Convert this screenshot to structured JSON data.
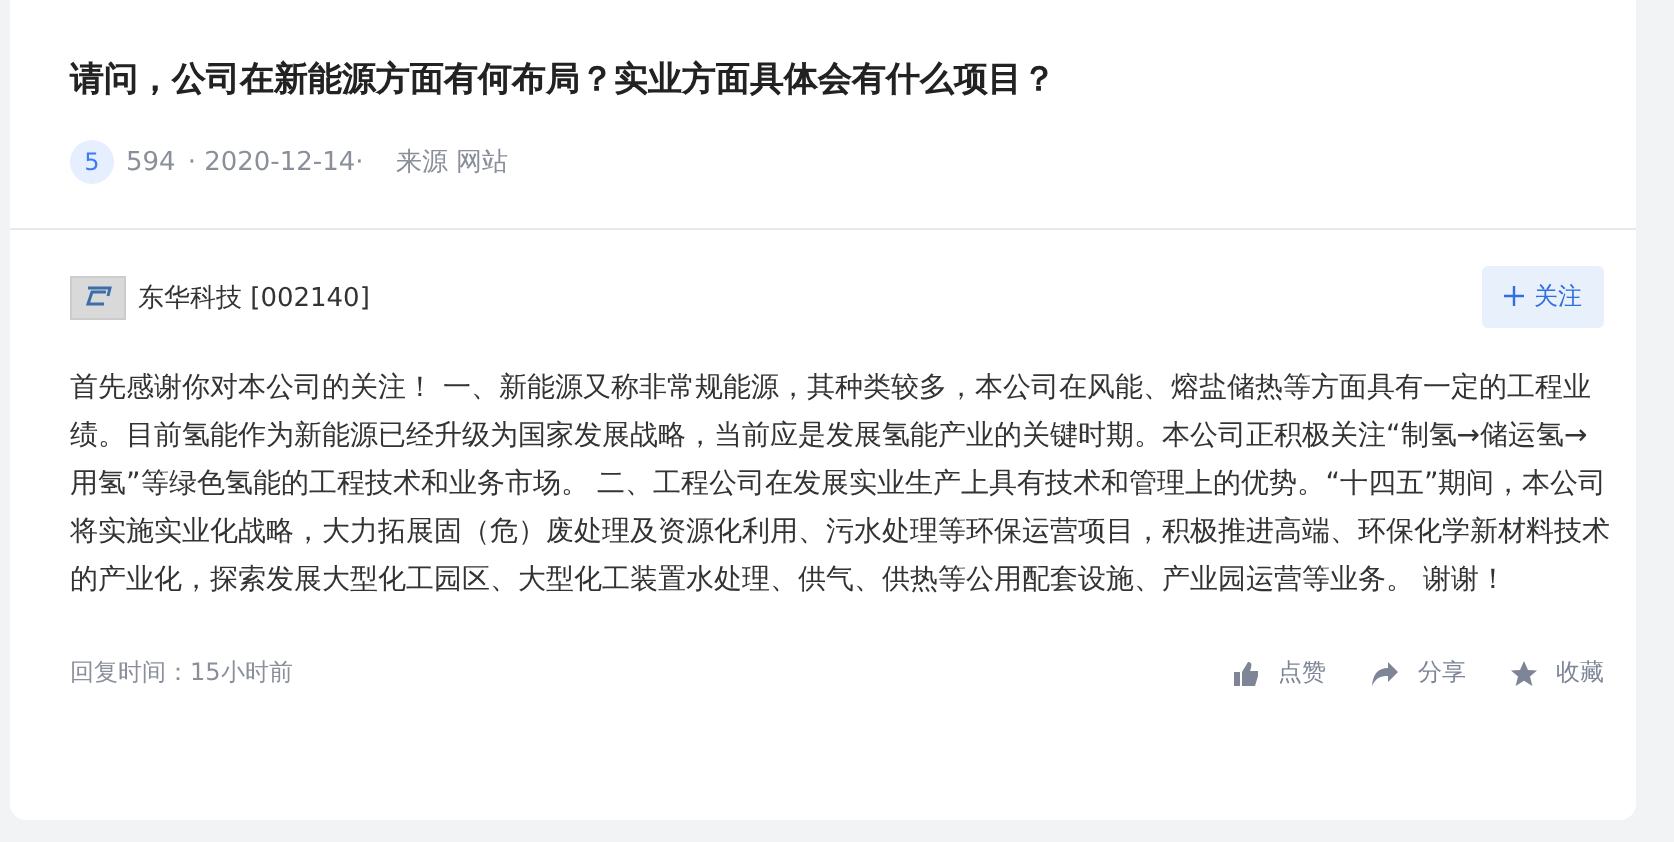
{
  "question": {
    "title": "请问，公司在新能源方面有何布局？实业方面具体会有什么项目？",
    "badge": "5",
    "views": "594",
    "date": "· 2020-12-14·",
    "source": "来源 网站"
  },
  "answer": {
    "company": "东华科技 [002140]",
    "follow_button": "关注",
    "text": "首先感谢你对本公司的关注！ 一、新能源又称非常规能源，其种类较多，本公司在风能、熔盐储热等方面具有一定的工程业绩。目前氢能作为新能源已经升级为国家发展战略，当前应是发展氢能产业的关键时期。本公司正积极关注“制氢→储运氢→用氢”等绿色氢能的工程技术和业务市场。 二、工程公司在发展实业生产上具有技术和管理上的优势。“十四五”期间，本公司将实施实业化战略，大力拓展固（危）废处理及资源化利用、污水处理等环保运营项目，积极推进高端、环保化学新材料技术的产业化，探索发展大型化工园区、大型化工装置水处理、供气、供热等公用配套设施、产业园运营等业务。 谢谢！",
    "reply_time": "回复时间：15小时前",
    "actions": [
      {
        "kind": "like",
        "label": "点赞"
      },
      {
        "kind": "share",
        "label": "分享"
      },
      {
        "kind": "favorite",
        "label": "收藏"
      }
    ]
  }
}
